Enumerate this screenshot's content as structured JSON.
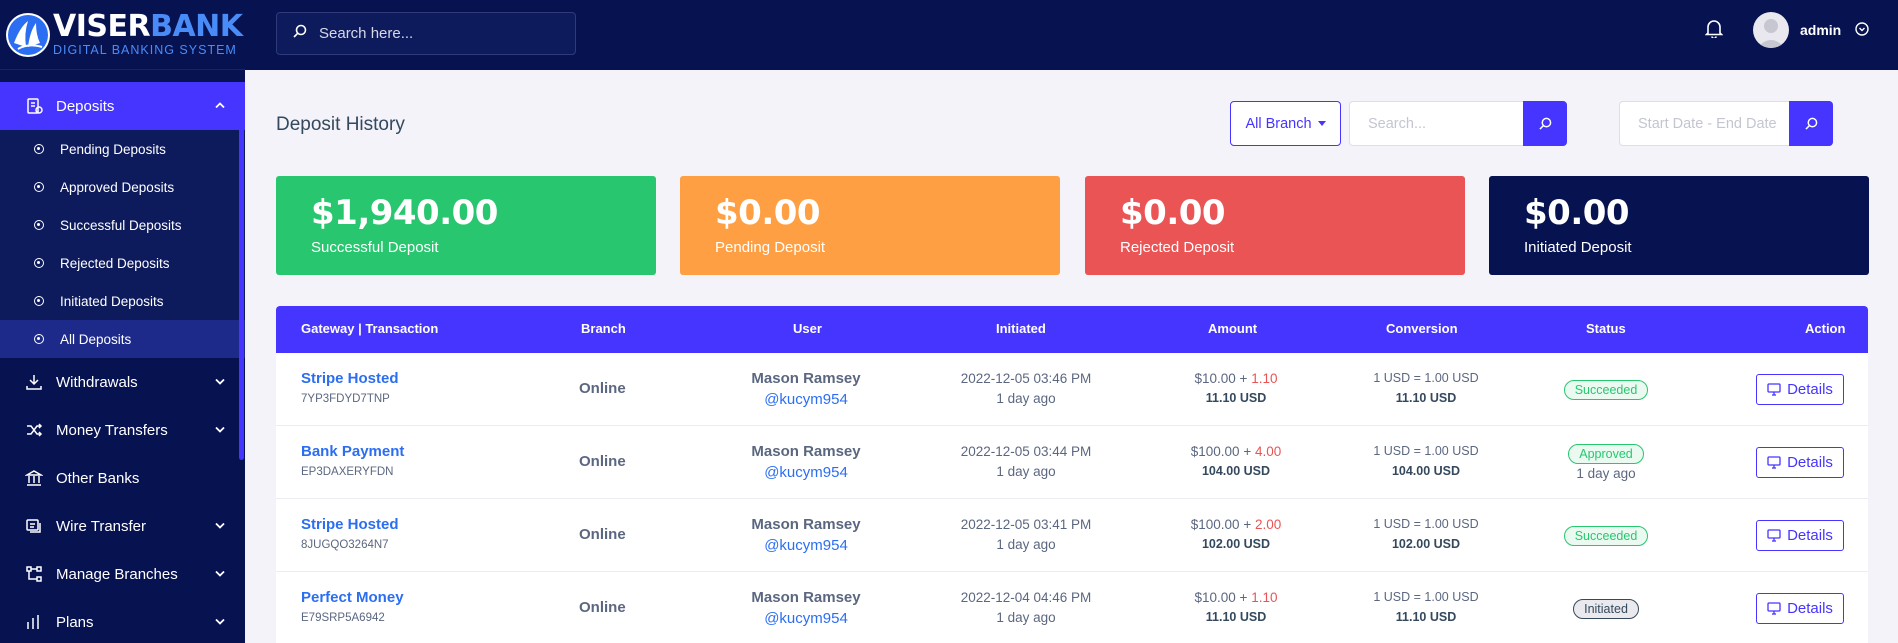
{
  "brand": {
    "title_white": "VISER",
    "title_blue": "BANK",
    "subtitle": "DIGITAL BANKING SYSTEM"
  },
  "sidebar": {
    "deposits": {
      "label": "Deposits"
    },
    "sub_items": [
      {
        "label": "Pending Deposits"
      },
      {
        "label": "Approved Deposits"
      },
      {
        "label": "Successful Deposits"
      },
      {
        "label": "Rejected Deposits"
      },
      {
        "label": "Initiated Deposits"
      },
      {
        "label": "All Deposits"
      }
    ],
    "items": [
      {
        "label": "Withdrawals",
        "icon": "withdraw-icon"
      },
      {
        "label": "Money Transfers",
        "icon": "shuffle-icon"
      },
      {
        "label": "Other Banks",
        "icon": "bank-icon"
      },
      {
        "label": "Wire Transfer",
        "icon": "wire-icon"
      },
      {
        "label": "Manage Branches",
        "icon": "branch-icon"
      },
      {
        "label": "Plans",
        "icon": "plans-icon"
      }
    ]
  },
  "topbar": {
    "search_placeholder": "Search here...",
    "admin_name": "admin"
  },
  "page": {
    "title": "Deposit History",
    "branch_filter": "All Branch",
    "search_placeholder": "Search...",
    "date_placeholder": "Start Date - End Date"
  },
  "cards": [
    {
      "amount": "$1,940.00",
      "label": "Successful Deposit",
      "color": "#28c76f"
    },
    {
      "amount": "$0.00",
      "label": "Pending Deposit",
      "color": "#ff9f43"
    },
    {
      "amount": "$0.00",
      "label": "Rejected Deposit",
      "color": "#ea5455"
    },
    {
      "amount": "$0.00",
      "label": "Initiated Deposit",
      "color": "#071251"
    }
  ],
  "table": {
    "headers": [
      "Gateway | Transaction",
      "Branch",
      "User",
      "Initiated",
      "Amount",
      "Conversion",
      "Status",
      "Action"
    ],
    "rows": [
      {
        "gateway": "Stripe Hosted",
        "trx": "7YP3FDYD7TNP",
        "branch": "Online",
        "user": "Mason Ramsey",
        "username": "@kucym954",
        "date": "2022-12-05 03:46 PM",
        "ago": "1 day ago",
        "amount": "$10.00 + ",
        "charge": "1.10",
        "total": "11.10 USD",
        "rate": "1 USD = 1.00 USD",
        "final": "11.10 USD",
        "status": "Succeeded",
        "status_ago": "",
        "action": "Details"
      },
      {
        "gateway": "Bank Payment",
        "trx": "EP3DAXERYFDN",
        "branch": "Online",
        "user": "Mason Ramsey",
        "username": "@kucym954",
        "date": "2022-12-05 03:44 PM",
        "ago": "1 day ago",
        "amount": "$100.00 + ",
        "charge": "4.00",
        "total": "104.00 USD",
        "rate": "1 USD = 1.00 USD",
        "final": "104.00 USD",
        "status": "Approved",
        "status_ago": "1 day ago",
        "action": "Details"
      },
      {
        "gateway": "Stripe Hosted",
        "trx": "8JUGQO3264N7",
        "branch": "Online",
        "user": "Mason Ramsey",
        "username": "@kucym954",
        "date": "2022-12-05 03:41 PM",
        "ago": "1 day ago",
        "amount": "$100.00 + ",
        "charge": "2.00",
        "total": "102.00 USD",
        "rate": "1 USD = 1.00 USD",
        "final": "102.00 USD",
        "status": "Succeeded",
        "status_ago": "",
        "action": "Details"
      },
      {
        "gateway": "Perfect Money",
        "trx": "E79SRP5A6942",
        "branch": "Online",
        "user": "Mason Ramsey",
        "username": "@kucym954",
        "date": "2022-12-04 04:46 PM",
        "ago": "1 day ago",
        "amount": "$10.00 + ",
        "charge": "1.10",
        "total": "11.10 USD",
        "rate": "1 USD = 1.00 USD",
        "final": "11.10 USD",
        "status": "Initiated",
        "status_ago": "",
        "action": "Details"
      }
    ]
  }
}
